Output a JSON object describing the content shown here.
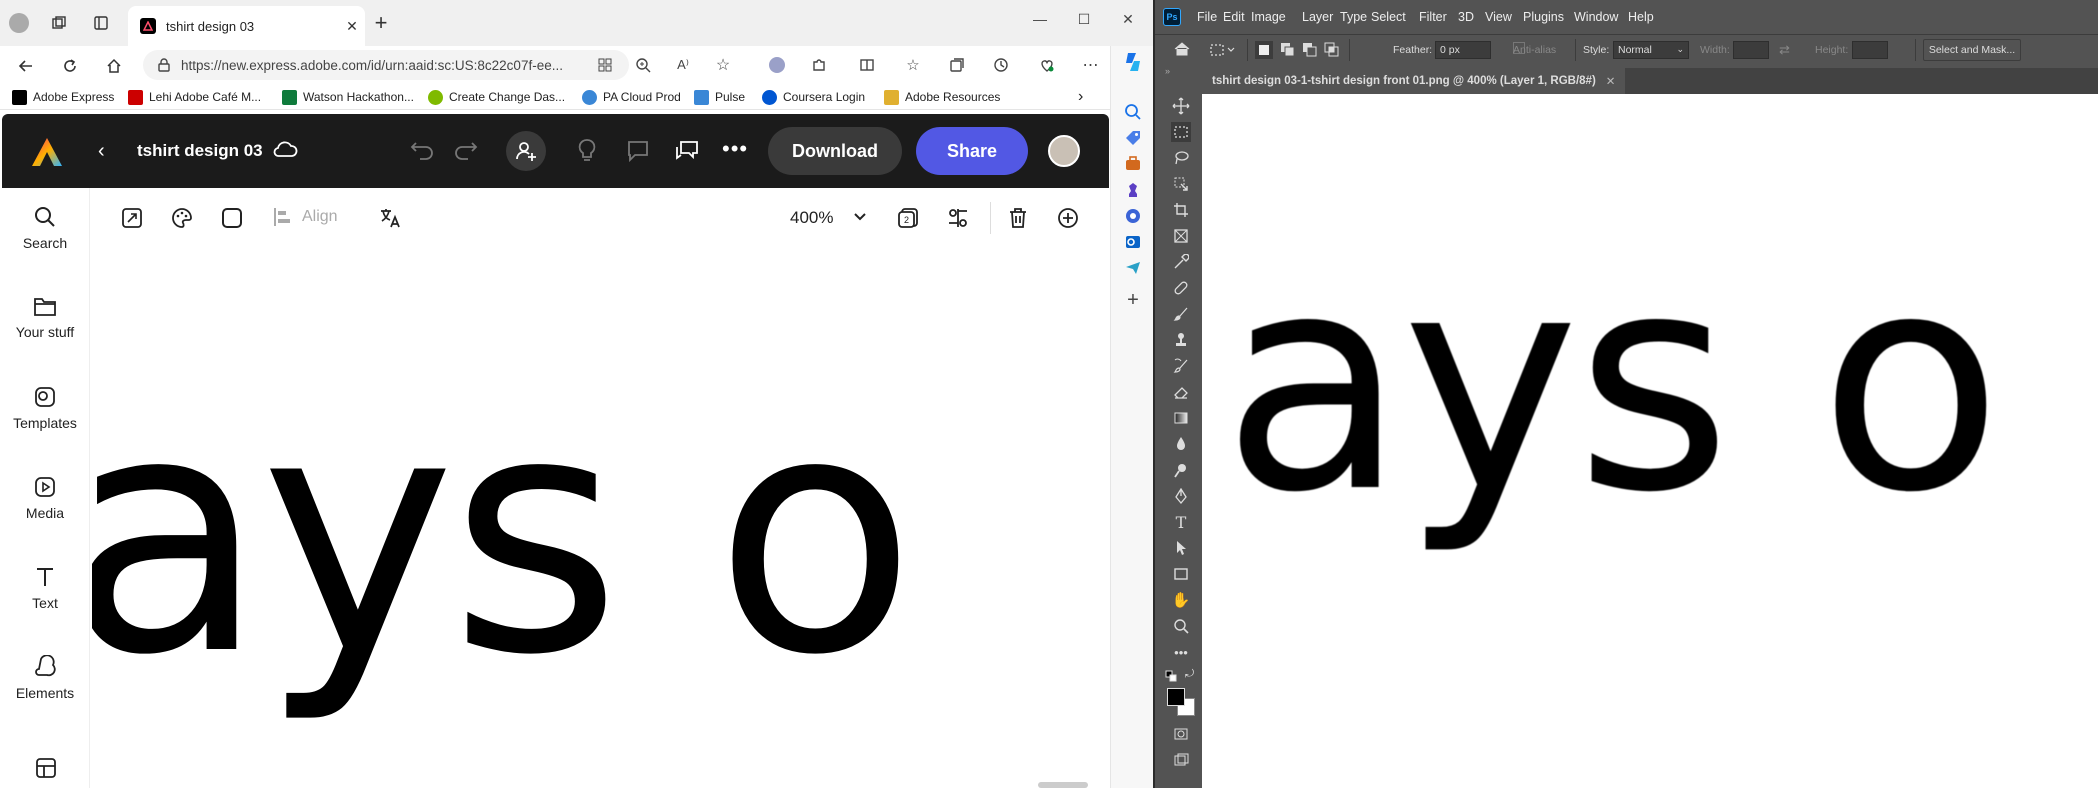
{
  "browser": {
    "tab_title": "tshirt design 03",
    "url": "https://new.express.adobe.com/id/urn:aaid:sc:US:8c22c07f-ee...",
    "bookmarks": [
      {
        "label": "Adobe Express",
        "color": "#000000"
      },
      {
        "label": "Lehi Adobe Café M...",
        "color": "#cc0000"
      },
      {
        "label": "Watson Hackathon...",
        "color": "#0f7b3c"
      },
      {
        "label": "Create Change Das...",
        "color": "#7fba00"
      },
      {
        "label": "PA Cloud Prod",
        "color": "#3a87d6"
      },
      {
        "label": "Pulse",
        "color": "#3a87d6"
      },
      {
        "label": "Coursera Login",
        "color": "#0056d2"
      },
      {
        "label": "Adobe Resources",
        "color": "#e0b030"
      }
    ]
  },
  "express": {
    "doc_title": "tshirt design 03",
    "download_label": "Download",
    "share_label": "Share",
    "share_color": "#5258e4",
    "align_label": "Align",
    "zoom": "400%",
    "left_nav": [
      {
        "label": "Search",
        "icon": "search-icon"
      },
      {
        "label": "Your stuff",
        "icon": "folder-icon"
      },
      {
        "label": "Templates",
        "icon": "templates-icon"
      },
      {
        "label": "Media",
        "icon": "media-icon"
      },
      {
        "label": "Text",
        "icon": "text-icon"
      },
      {
        "label": "Elements",
        "icon": "elements-icon"
      }
    ],
    "canvas_text": "ays o"
  },
  "photoshop": {
    "menu": [
      "File",
      "Edit",
      "Image",
      "Layer",
      "Type",
      "Select",
      "Filter",
      "3D",
      "View",
      "Plugins",
      "Window",
      "Help"
    ],
    "options": {
      "feather_label": "Feather:",
      "feather_value": "0 px",
      "antialias_label": "Anti-alias",
      "style_label": "Style:",
      "style_value": "Normal",
      "width_label": "Width:",
      "height_label": "Height:",
      "select_mask_label": "Select and Mask..."
    },
    "doc_tab": "tshirt design 03-1-tshirt design front 01.png @ 400% (Layer 1, RGB/8#)",
    "canvas_text": "ays o"
  }
}
